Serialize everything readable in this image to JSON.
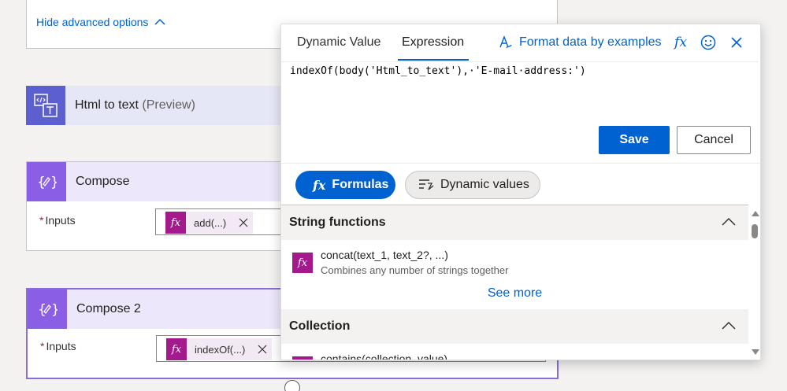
{
  "canvas": {
    "advanced_toggle": "Hide advanced options",
    "html_action": {
      "title": "Html to text",
      "suffix": "(Preview)"
    },
    "compose": {
      "title": "Compose",
      "inputs_label": "Inputs",
      "required_mark": "*",
      "token_label": "add(...)"
    },
    "compose2": {
      "title": "Compose 2",
      "inputs_label": "Inputs",
      "required_mark": "*",
      "token_label": "indexOf(...)"
    }
  },
  "panel": {
    "tabs": {
      "dynamic": "Dynamic Value",
      "expression": "Expression"
    },
    "format_link": "Format data by examples",
    "expression_text": "indexOf(body('Html_to_text'),·'E-mail·address:')",
    "buttons": {
      "save": "Save",
      "cancel": "Cancel"
    },
    "pills": {
      "formulas": "Formulas",
      "dynamic_values": "Dynamic values"
    },
    "sections": [
      {
        "title": "String functions"
      },
      {
        "title": "Collection"
      }
    ],
    "functions": [
      {
        "name": "concat(text_1, text_2?, ...)",
        "description": "Combines any number of strings together"
      },
      {
        "name": "contains(collection, value)"
      }
    ],
    "see_more": "See more"
  },
  "colors": {
    "accent": "#0062d1",
    "function_token": "#a4198b",
    "html_action": "#5c5fcf",
    "compose_action": "#8a5fe6"
  }
}
